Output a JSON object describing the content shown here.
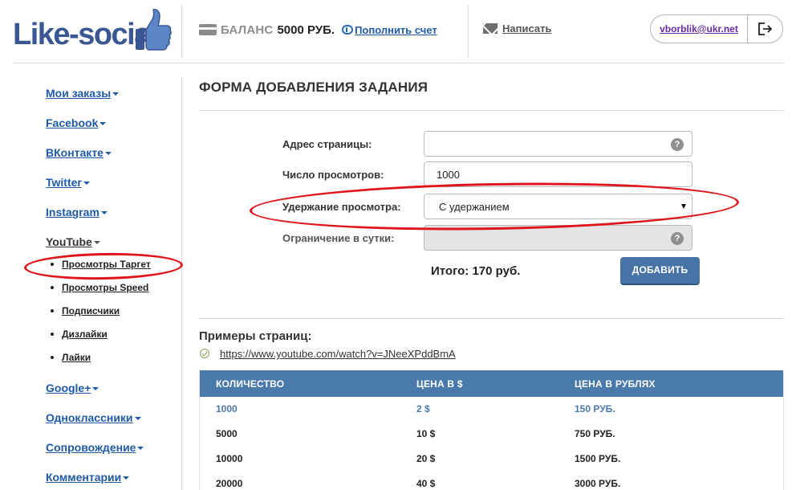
{
  "header": {
    "logo_text": "Like-social",
    "balance_label": "БАЛАНС",
    "balance_value": "5000 РУБ.",
    "topup_label": "Пополнить счет",
    "write_label": "Написать",
    "user_email": "vborblik@ukr.net",
    "icons": [
      "thumbs-up-icon",
      "card-icon",
      "coin-icon",
      "mail-icon",
      "logout-icon"
    ]
  },
  "sidebar": {
    "items": [
      {
        "label": "Мои заказы"
      },
      {
        "label": "Facebook"
      },
      {
        "label": "ВКонтакте"
      },
      {
        "label": "Twitter"
      },
      {
        "label": "Instagram"
      },
      {
        "label": "YouTube"
      },
      {
        "label": "Google+"
      },
      {
        "label": "Одноклассники"
      },
      {
        "label": "Сопровождение"
      },
      {
        "label": "Комментарии"
      }
    ],
    "youtube_subitems": [
      {
        "label": "Просмотры Таргет"
      },
      {
        "label": "Просмотры Speed"
      },
      {
        "label": "Подписчики"
      },
      {
        "label": "Дизлайки"
      },
      {
        "label": "Лайки"
      }
    ]
  },
  "form": {
    "title": "ФОРМА ДОБАВЛЕНИЯ ЗАДАНИЯ",
    "fields": [
      {
        "label": "Адрес страницы:",
        "value": ""
      },
      {
        "label": "Число просмотров:",
        "value": "1000"
      },
      {
        "label": "Удержание просмотра:",
        "value": "С удержанием"
      },
      {
        "label": "Ограничение в сутки:",
        "value": ""
      }
    ],
    "help_glyph": "?",
    "total": "Итого: 170 руб.",
    "submit_label": "ДОБАВИТЬ"
  },
  "examples": {
    "title": "Примеры страниц:",
    "link": "https://www.youtube.com/watch?v=JNeeXPddBmA"
  },
  "price_table": {
    "headers": [
      "КОЛИЧЕСТВО",
      "ЦЕНА В $",
      "ЦЕНА В РУБЛЯХ"
    ],
    "rows": [
      [
        "1000",
        "2 $",
        "150 РУБ."
      ],
      [
        "5000",
        "10 $",
        "750 РУБ."
      ],
      [
        "10000",
        "20 $",
        "1500 РУБ."
      ],
      [
        "20000",
        "40 $",
        "3000 РУБ."
      ]
    ]
  },
  "colors": {
    "brand": "#3a5793",
    "link": "#1f5aa6",
    "button": "#4674a7",
    "table_header": "#4a7aaa",
    "annotation": "#e0151b"
  }
}
